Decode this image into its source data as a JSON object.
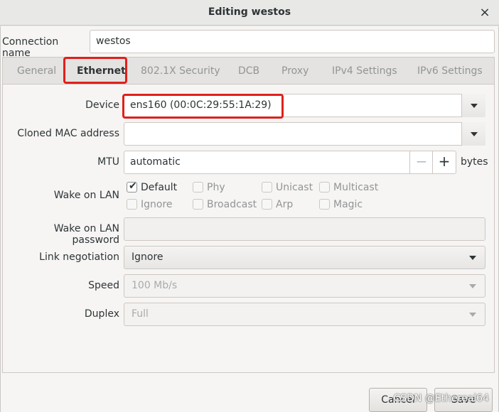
{
  "window": {
    "title": "Editing westos",
    "close_glyph": "×"
  },
  "connection": {
    "label": "Connection name",
    "value": "westos"
  },
  "tabs": [
    {
      "label": "General"
    },
    {
      "label": "Ethernet"
    },
    {
      "label": "802.1X Security"
    },
    {
      "label": "DCB"
    },
    {
      "label": "Proxy"
    },
    {
      "label": "IPv4 Settings"
    },
    {
      "label": "IPv6 Settings"
    }
  ],
  "active_tab": "Ethernet",
  "ethernet": {
    "device": {
      "label": "Device",
      "value": "ens160 (00:0C:29:55:1A:29)"
    },
    "cloned_mac": {
      "label": "Cloned MAC address",
      "value": ""
    },
    "mtu": {
      "label": "MTU",
      "value": "automatic",
      "minus": "−",
      "plus": "+",
      "unit": "bytes"
    },
    "wake_on_lan": {
      "label": "Wake on LAN",
      "options": [
        {
          "label": "Default",
          "checked": true
        },
        {
          "label": "Phy",
          "checked": false
        },
        {
          "label": "Unicast",
          "checked": false
        },
        {
          "label": "Multicast",
          "checked": false
        },
        {
          "label": "Ignore",
          "checked": false
        },
        {
          "label": "Broadcast",
          "checked": false
        },
        {
          "label": "Arp",
          "checked": false
        },
        {
          "label": "Magic",
          "checked": false
        }
      ]
    },
    "wol_password": {
      "label": "Wake on LAN password",
      "value": ""
    },
    "link_negotiation": {
      "label": "Link negotiation",
      "value": "Ignore"
    },
    "speed": {
      "label": "Speed",
      "value": "100 Mb/s"
    },
    "duplex": {
      "label": "Duplex",
      "value": "Full"
    }
  },
  "footer": {
    "cancel": "Cancel",
    "save": "Save"
  },
  "watermark": "CSDN @Ethereal64",
  "colors": {
    "highlight": "#e0201c",
    "text": "#2e3436",
    "disabled_text": "#929595"
  }
}
